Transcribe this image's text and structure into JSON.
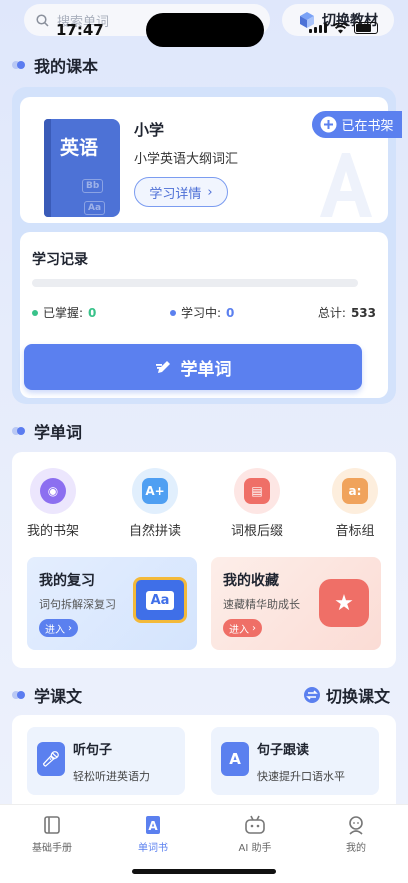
{
  "status": {
    "time": "17:47"
  },
  "search": {
    "placeholder": "搜索单词"
  },
  "header": {
    "switch_label": "切换教材"
  },
  "my_book": {
    "section_title": "我的课本",
    "book_cover_text": "英语",
    "level": "小学",
    "book_name": "小学英语大纲词汇",
    "detail_label": "学习详情",
    "shelf_label": "已在书架"
  },
  "record": {
    "title": "学习记录",
    "progress": 0,
    "mastered_label": "已掌握:",
    "mastered_value": "0",
    "learning_label": "学习中:",
    "learning_value": "0",
    "total_label": "总计:",
    "total_value": "533",
    "cta_label": "学单词"
  },
  "words": {
    "section_title": "学单词",
    "tools": [
      {
        "label": "我的书架",
        "icon": "bookshelf-icon",
        "color": "#8c6ff0"
      },
      {
        "label": "自然拼读",
        "icon": "phonics-icon",
        "color": "#4f9ff2"
      },
      {
        "label": "词根后缀",
        "icon": "root-book-icon",
        "color": "#ef6f67"
      },
      {
        "label": "音标组",
        "icon": "phonetic-icon",
        "color": "#f0a35c"
      }
    ],
    "review": {
      "title": "我的复习",
      "subtitle": "词句拆解深复习",
      "enter": "进入",
      "art_text": "Aa"
    },
    "favorites": {
      "title": "我的收藏",
      "subtitle": "速藏精华助成长",
      "enter": "进入"
    }
  },
  "courses": {
    "section_title": "学课文",
    "switch_label": "切换课文",
    "items": [
      {
        "title": "听句子",
        "subtitle": "轻松听进英语力"
      },
      {
        "title": "句子跟读",
        "subtitle": "快速提升口语水平"
      }
    ]
  },
  "tabs": [
    {
      "label": "基础手册",
      "icon": "handbook-icon"
    },
    {
      "label": "单词书",
      "icon": "wordbook-icon"
    },
    {
      "label": "AI 助手",
      "icon": "robot-icon"
    },
    {
      "label": "我的",
      "icon": "profile-icon"
    }
  ],
  "colors": {
    "accent": "#5b80ef",
    "mastered": "#39c28a",
    "learning": "#5b80ef",
    "active_tab": "#5b80ef"
  }
}
